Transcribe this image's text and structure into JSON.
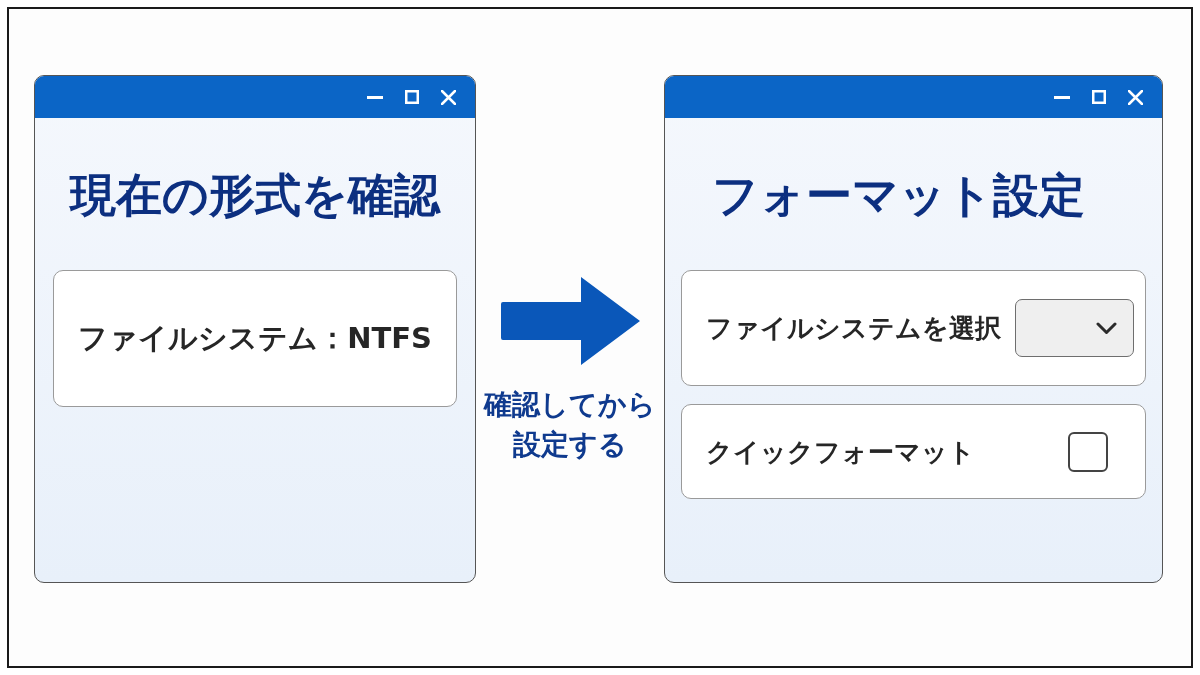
{
  "left_window": {
    "heading": "現在の形式を確認",
    "info_card": "ファイルシステム：NTFS"
  },
  "arrow": {
    "caption": "確認してから設定する"
  },
  "right_window": {
    "heading": "フォーマット設定",
    "options": [
      {
        "kind": "dropdown",
        "label": "ファイルシステムを選択"
      },
      {
        "kind": "checkbox",
        "label": "クイックフォーマット",
        "checked": false
      }
    ]
  }
}
